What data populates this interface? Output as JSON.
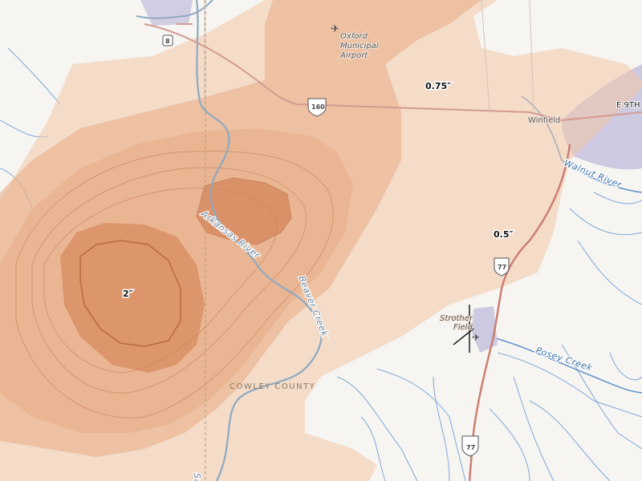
{
  "map": {
    "contour_labels": {
      "c200": "2″",
      "c075": "0.75″",
      "c050": "0.5″"
    },
    "places": {
      "oxford_airport": "Oxford Municipal Airport",
      "oxford_airport_lines": [
        "Oxford",
        "Municipal",
        "Airport"
      ],
      "winfield": "Winfield",
      "strother_field_lines": [
        "Strother",
        "Field"
      ],
      "e9th": "E 9TH"
    },
    "water": {
      "arkansas_river": "Arkansas River",
      "walnut_river": "Walnut River",
      "beaver_creek": "Beaver Creek",
      "posey_creek": "Posey Creek",
      "salt": "Salt"
    },
    "county": "COWLEY COUNTY",
    "routes": {
      "us160": "160",
      "us77_north": "77",
      "us77_south": "77",
      "route8": "8"
    },
    "colors": {
      "band_outer": "#f2c7a8",
      "band_mid": "#e7a67e",
      "band_inner": "#d27a4c",
      "water": "#6f9fd0",
      "road": "#c98b82",
      "urban": "#b3b0d0"
    }
  }
}
